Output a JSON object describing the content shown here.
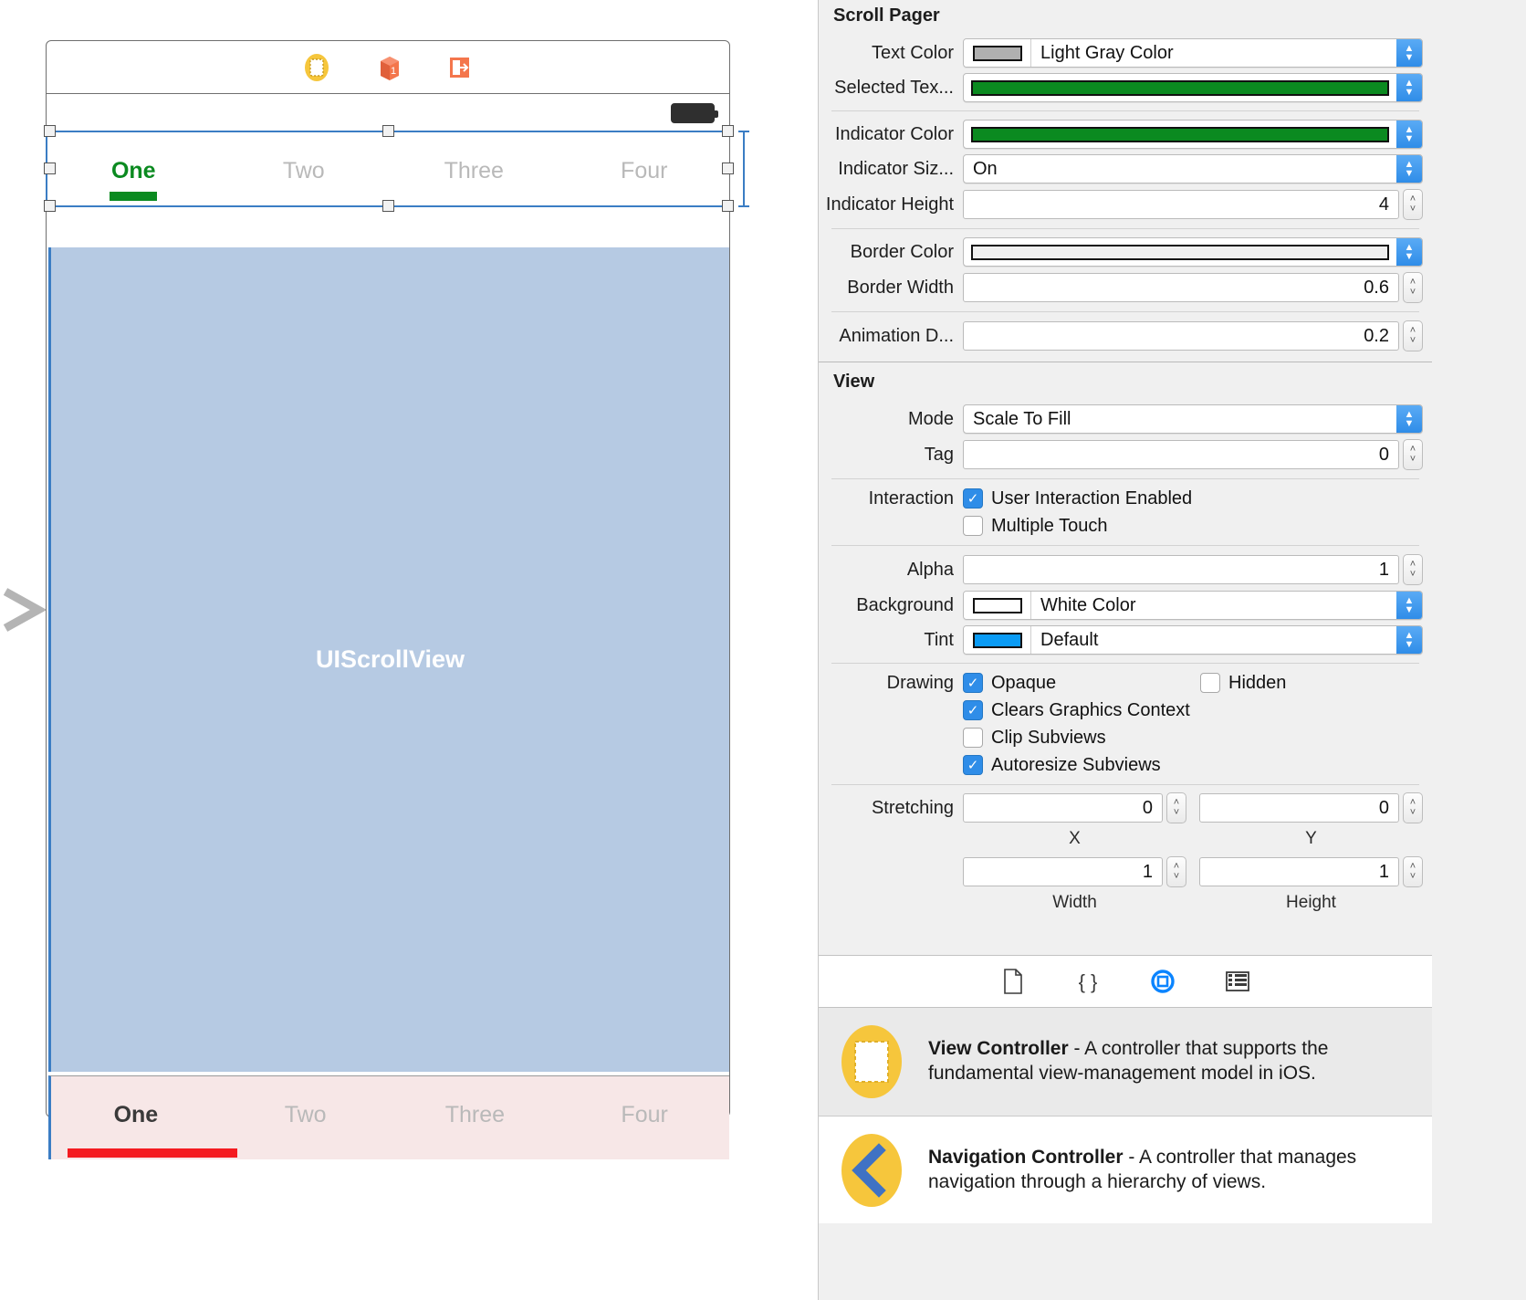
{
  "canvas": {
    "scene_dock": [
      {
        "name": "view-controller-icon",
        "title": "View Controller"
      },
      {
        "name": "first-responder-icon",
        "title": "First Responder"
      },
      {
        "name": "exit-icon",
        "title": "Exit"
      }
    ],
    "status_bar": {
      "battery_icon": "battery-icon"
    },
    "top_pager": {
      "tabs": [
        {
          "label": "One",
          "selected": true
        },
        {
          "label": "Two",
          "selected": false
        },
        {
          "label": "Three",
          "selected": false
        },
        {
          "label": "Four",
          "selected": false
        }
      ],
      "indicator_color": "#0b8a20",
      "text_color": "#b9b9b9",
      "selected_text_color": "#0b8a20"
    },
    "scroll_view": {
      "label": "UIScrollView",
      "background": "#b6cae3"
    },
    "bottom_pager": {
      "tabs": [
        {
          "label": "One",
          "selected": true
        },
        {
          "label": "Two",
          "selected": false
        },
        {
          "label": "Three",
          "selected": false
        },
        {
          "label": "Four",
          "selected": false
        }
      ],
      "indicator_color": "#f41b20",
      "background": "#f7e7e7",
      "selected_text_color": "#3a3a3a"
    }
  },
  "inspector": {
    "scroll_pager": {
      "title": "Scroll Pager",
      "text_color": {
        "label": "Text Color",
        "value": "Light Gray Color",
        "swatch": "#b0b0b0"
      },
      "selected_text_color": {
        "label": "Selected Tex...",
        "value": "",
        "swatch": "#0b8a20"
      },
      "indicator_color": {
        "label": "Indicator Color",
        "value": "",
        "swatch": "#0b8a20"
      },
      "indicator_size": {
        "label": "Indicator Siz...",
        "value": "On"
      },
      "indicator_height": {
        "label": "Indicator Height",
        "value": "4"
      },
      "border_color": {
        "label": "Border Color",
        "value": "",
        "swatch": "#efefef"
      },
      "border_width": {
        "label": "Border Width",
        "value": "0.6"
      },
      "animation_duration": {
        "label": "Animation D...",
        "value": "0.2"
      }
    },
    "view": {
      "title": "View",
      "mode": {
        "label": "Mode",
        "value": "Scale To Fill"
      },
      "tag": {
        "label": "Tag",
        "value": "0"
      },
      "interaction": {
        "label": "Interaction",
        "items": [
          {
            "label": "User Interaction Enabled",
            "checked": true
          },
          {
            "label": "Multiple Touch",
            "checked": false
          }
        ]
      },
      "alpha": {
        "label": "Alpha",
        "value": "1"
      },
      "background": {
        "label": "Background",
        "value": "White Color",
        "swatch": "#ffffff"
      },
      "tint": {
        "label": "Tint",
        "value": "Default",
        "swatch": "#0a9bf5"
      },
      "drawing": {
        "label": "Drawing",
        "items": [
          {
            "label": "Opaque",
            "checked": true
          },
          {
            "label": "Hidden",
            "checked": false
          },
          {
            "label": "Clears Graphics Context",
            "checked": true
          },
          {
            "label": "Clip Subviews",
            "checked": false
          },
          {
            "label": "Autoresize Subviews",
            "checked": true
          }
        ]
      },
      "stretching": {
        "label": "Stretching",
        "x": {
          "value": "0",
          "caption": "X"
        },
        "y": {
          "value": "0",
          "caption": "Y"
        },
        "width": {
          "value": "1",
          "caption": "Width"
        },
        "height": {
          "value": "1",
          "caption": "Height"
        }
      }
    },
    "library": {
      "tabs": [
        {
          "name": "file-template-library-icon",
          "selected": false
        },
        {
          "name": "code-snippet-library-icon",
          "selected": false
        },
        {
          "name": "object-library-icon",
          "selected": true
        },
        {
          "name": "media-library-icon",
          "selected": false
        }
      ],
      "items": [
        {
          "icon": "view-controller-library-icon",
          "title": "View Controller",
          "desc": " - A controller that supports the fundamental view-management model in iOS."
        },
        {
          "icon": "navigation-controller-library-icon",
          "title": "Navigation Controller",
          "desc": " - A controller that manages navigation through a hierarchy of views."
        }
      ]
    }
  }
}
